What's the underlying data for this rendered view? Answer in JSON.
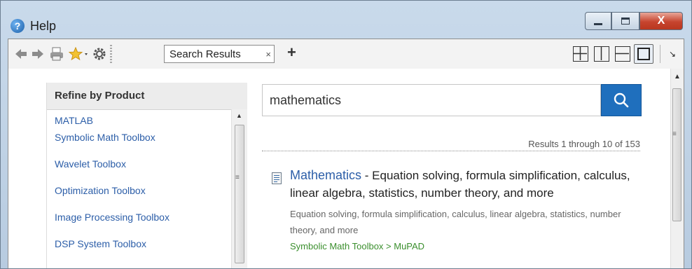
{
  "window": {
    "title": "Help",
    "close_glyph": "X"
  },
  "toolbar": {
    "tab_label": "Search Results",
    "tab_close": "×",
    "new_tab": "+",
    "icons": [
      "back-arrow-icon",
      "forward-arrow-icon",
      "print-icon",
      "favorites-star-icon",
      "settings-gear-icon"
    ],
    "layout_icons": [
      "layout-grid-icon",
      "layout-vertical-split-icon",
      "layout-horizontal-split-icon",
      "layout-single-icon"
    ]
  },
  "refine": {
    "heading": "Refine by Product",
    "products": [
      {
        "label": "MATLAB"
      },
      {
        "label": "Symbolic Math Toolbox"
      },
      {
        "label": "Wavelet Toolbox"
      },
      {
        "label": "Optimization Toolbox"
      },
      {
        "label": "Image Processing Toolbox"
      },
      {
        "label": "DSP System Toolbox"
      }
    ]
  },
  "search": {
    "value": "mathematics"
  },
  "results": {
    "count_text": "Results 1 through 10 of 153",
    "items": [
      {
        "title": "Mathematics",
        "summary": " - Equation solving, formula simplification, calculus, linear algebra, statistics, number theory, and more",
        "description": "Equation solving, formula simplification, calculus, linear algebra, statistics, number theory, and more",
        "path": "Symbolic Math Toolbox > MuPAD"
      }
    ]
  },
  "colors": {
    "link": "#2c5ea8",
    "path_green": "#3b8f2e",
    "search_button": "#1f6fbd",
    "close_button": "#c7442e"
  }
}
